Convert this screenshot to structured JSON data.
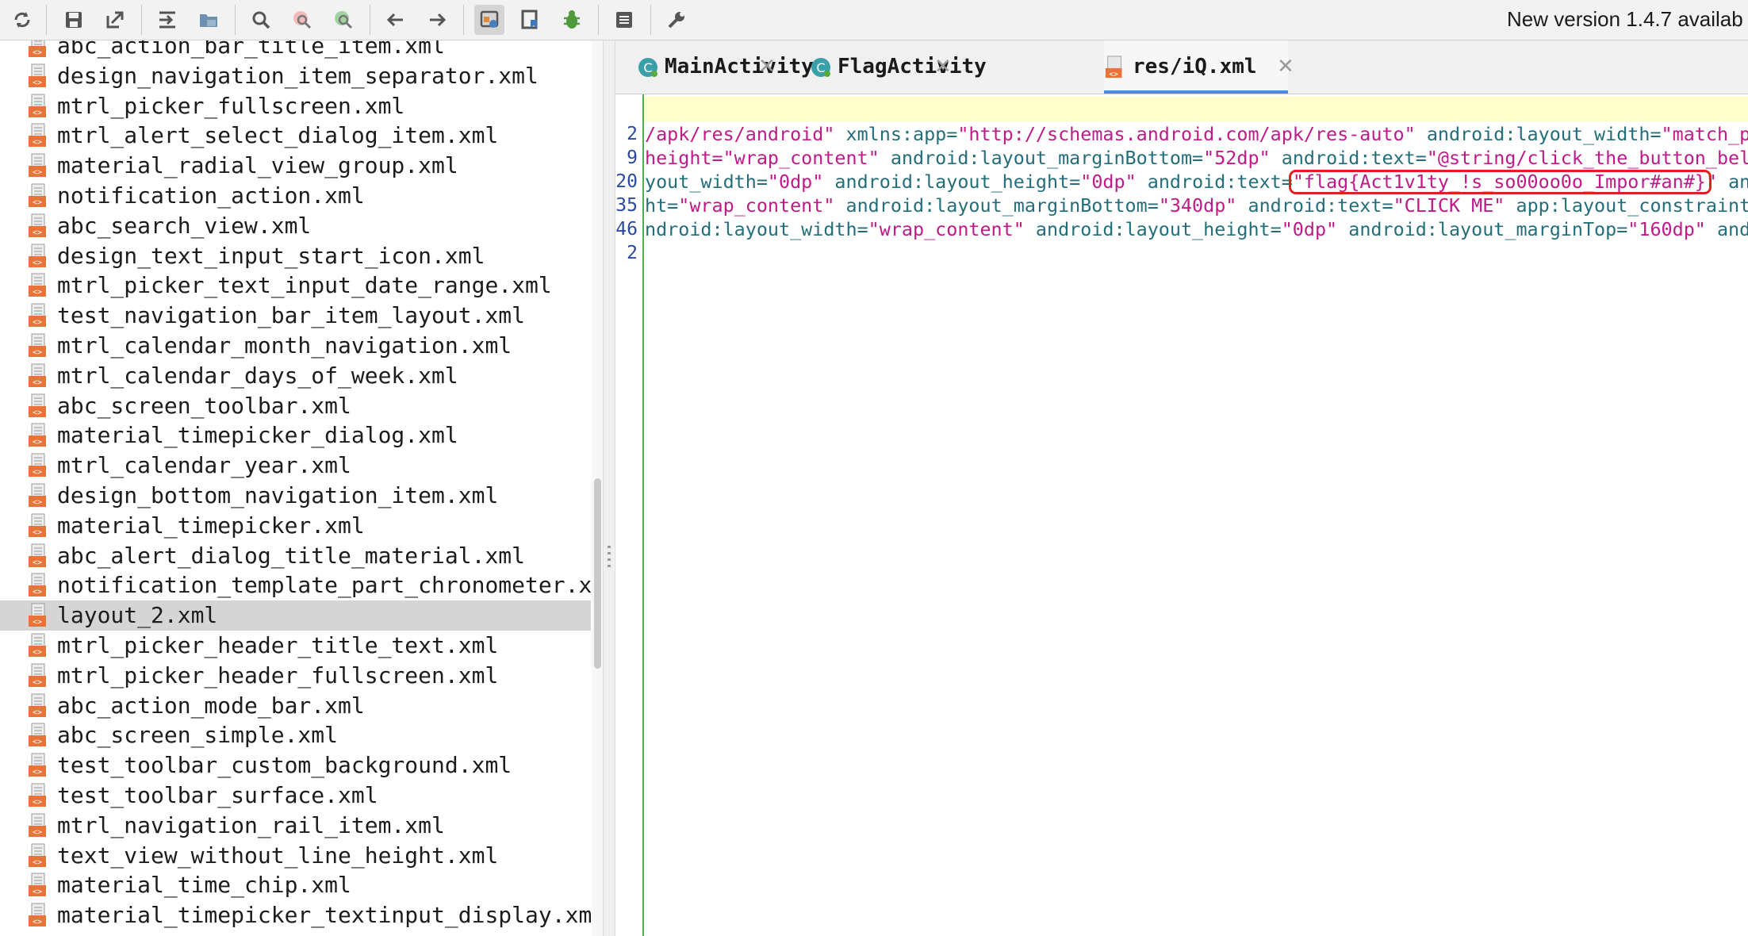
{
  "toolbar": {
    "buttons": [
      {
        "name": "sync-icon"
      },
      {
        "name": "save-icon"
      },
      {
        "name": "export-icon"
      },
      {
        "name": "navigate-icon"
      },
      {
        "name": "open-folder-icon"
      },
      {
        "name": "search-icon"
      },
      {
        "name": "find-class-icon"
      },
      {
        "name": "find-usage-icon"
      },
      {
        "name": "back-arrow-icon"
      },
      {
        "name": "forward-arrow-icon"
      },
      {
        "name": "decompile-mode-icon"
      },
      {
        "name": "bookmark-icon"
      },
      {
        "name": "debug-bug-icon"
      },
      {
        "name": "log-icon"
      },
      {
        "name": "wrench-settings-icon"
      }
    ],
    "update_notice": "New version 1.4.7 availab"
  },
  "file_tree": {
    "items": [
      "abc_action_bar_title_item.xml",
      "design_navigation_item_separator.xml",
      "mtrl_picker_fullscreen.xml",
      "mtrl_alert_select_dialog_item.xml",
      "material_radial_view_group.xml",
      "notification_action.xml",
      "abc_search_view.xml",
      "design_text_input_start_icon.xml",
      "mtrl_picker_text_input_date_range.xml",
      "test_navigation_bar_item_layout.xml",
      "mtrl_calendar_month_navigation.xml",
      "mtrl_calendar_days_of_week.xml",
      "abc_screen_toolbar.xml",
      "material_timepicker_dialog.xml",
      "mtrl_calendar_year.xml",
      "design_bottom_navigation_item.xml",
      "material_timepicker.xml",
      "abc_alert_dialog_title_material.xml",
      "notification_template_part_chronometer.xml",
      "layout_2.xml",
      "mtrl_picker_header_title_text.xml",
      "mtrl_picker_header_fullscreen.xml",
      "abc_action_mode_bar.xml",
      "abc_screen_simple.xml",
      "test_toolbar_custom_background.xml",
      "test_toolbar_surface.xml",
      "mtrl_navigation_rail_item.xml",
      "text_view_without_line_height.xml",
      "material_time_chip.xml",
      "material_timepicker_textinput_display.xml"
    ],
    "selected_index": 19
  },
  "tabs": [
    {
      "label": "MainActivity",
      "icon": "class-icon",
      "active": false
    },
    {
      "label": "FlagActivity",
      "icon": "class-icon",
      "active": false
    },
    {
      "label": "res/iQ.xml",
      "icon": "xml-file-icon",
      "active": true
    }
  ],
  "editor": {
    "line_numbers": [
      "2",
      "9",
      "20",
      "35",
      "46",
      "2"
    ],
    "lines": [
      "",
      [
        [
          "s",
          "/apk/res/android\""
        ],
        [
          "t",
          " "
        ],
        [
          "a",
          "xmlns:app="
        ],
        [
          "s",
          "\"http://schemas.android.com/apk/res-auto\""
        ],
        [
          "t",
          " "
        ],
        [
          "a",
          "android:layout_width="
        ],
        [
          "s",
          "\"match_pa"
        ]
      ],
      [
        [
          "s",
          "height=\"wrap_content\""
        ],
        [
          "t",
          " "
        ],
        [
          "a",
          "android:layout_marginBottom="
        ],
        [
          "s",
          "\"52dp\""
        ],
        [
          "t",
          " "
        ],
        [
          "a",
          "android:text="
        ],
        [
          "s",
          "\"@string/click_the_button_belo"
        ]
      ],
      [
        [
          "a",
          "yout_width="
        ],
        [
          "s",
          "\"0dp\""
        ],
        [
          "t",
          " "
        ],
        [
          "a",
          "android:layout_height="
        ],
        [
          "s",
          "\"0dp\""
        ],
        [
          "t",
          " "
        ],
        [
          "a",
          "android:text="
        ],
        [
          "s",
          "\"flag{Act1v1ty_!s_so00oo0o_Impor#an#}\""
        ],
        [
          "t",
          " "
        ],
        [
          "a",
          "anc"
        ]
      ],
      [
        [
          "a",
          "ht="
        ],
        [
          "s",
          "\"wrap_content\""
        ],
        [
          "t",
          " "
        ],
        [
          "a",
          "android:layout_marginBottom="
        ],
        [
          "s",
          "\"340dp\""
        ],
        [
          "t",
          " "
        ],
        [
          "a",
          "android:text="
        ],
        [
          "s",
          "\"CLICK ME\""
        ],
        [
          "t",
          " "
        ],
        [
          "a",
          "app:layout_constraintE"
        ]
      ],
      [
        [
          "a",
          "ndroid:layout_width="
        ],
        [
          "s",
          "\"wrap_content\""
        ],
        [
          "t",
          " "
        ],
        [
          "a",
          "android:layout_height="
        ],
        [
          "s",
          "\"0dp\""
        ],
        [
          "t",
          " "
        ],
        [
          "a",
          "android:layout_marginTop="
        ],
        [
          "s",
          "\"160dp\""
        ],
        [
          "t",
          " "
        ],
        [
          "a",
          "andr"
        ]
      ]
    ],
    "highlighted_flag": "\"flag{Act1v1ty_!s_so00oo0o_Impor#an#}\"",
    "colors": {
      "attribute": "#236e7a",
      "string": "#c01a88",
      "gutter_line": "#4caf50",
      "highlight_box": "#e02020",
      "current_line": "#ffffcc"
    }
  }
}
